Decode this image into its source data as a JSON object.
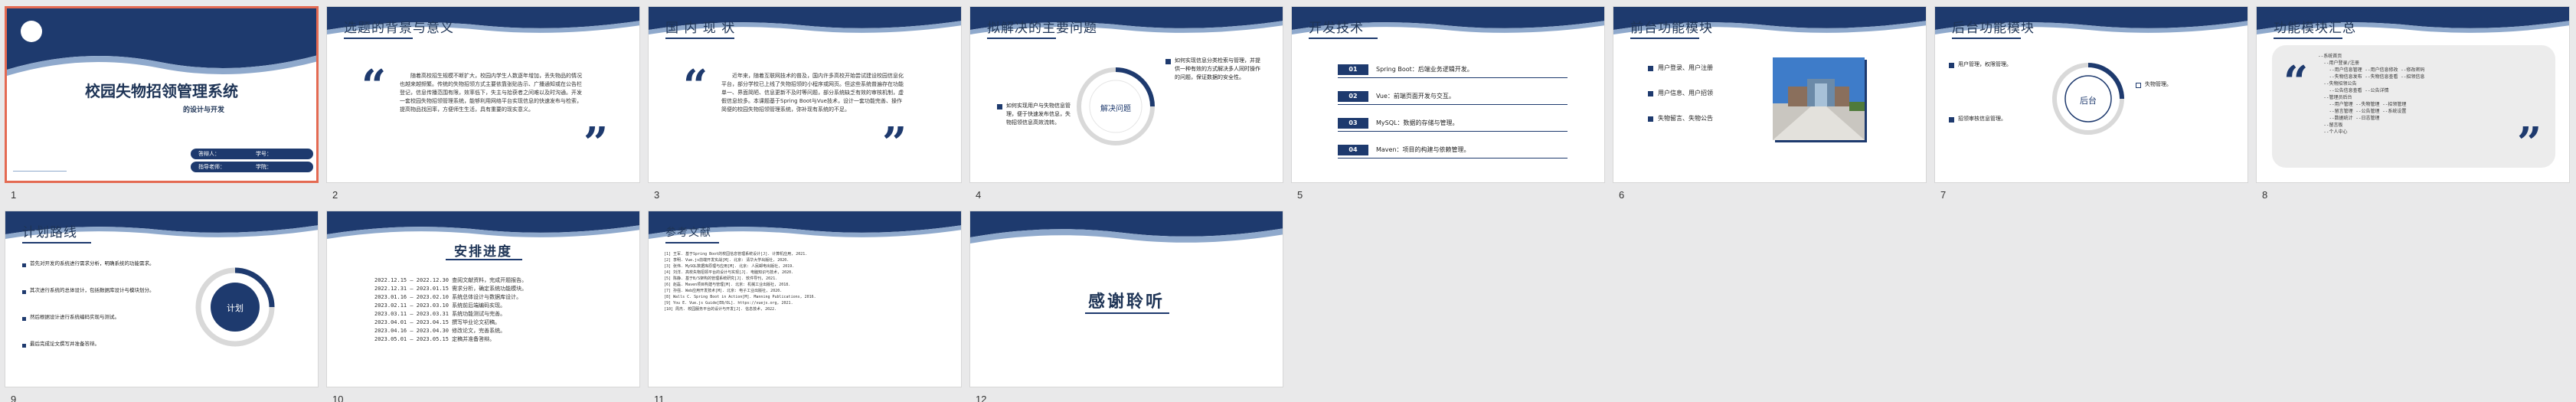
{
  "slides": [
    {
      "num": "1",
      "title": "校园失物招领管理系统",
      "subtitle": "的设计与开发",
      "info1_a": "答辩人：",
      "info1_b": "学号：",
      "info2_a": "指导老师：",
      "info2_b": "学院："
    },
    {
      "num": "2",
      "title": "选题的背景与意义",
      "para": "随着高校招生规模不断扩大，校园内学生人数逐年增加，丢失物品的情况也越来越频繁。传统的失物招领方式主要依靠张贴告示、广播通知或在公告栏登记，信息传播范围有限，效率低下，失主与拾获者之间难以及时沟通。开发一套校园失物招领管理系统，能够利用网络平台实现信息的快速发布与检索，提高物品找回率，方便师生生活，具有重要的现实意义。"
    },
    {
      "num": "3",
      "title": "国 内 现 状",
      "para": "近年来，随着互联网技术的普及，国内许多高校开始尝试建设校园信息化平台，部分学校已上线了失物招领的小程序或网页。但这些系统普遍存在功能单一、界面简陋、信息更新不及时等问题，部分系统缺乏有效的审核机制，虚假信息较多。本课题基于Spring Boot与Vue技术，设计一套功能完善、操作简便的校园失物招领管理系统，弥补现有系统的不足。"
    },
    {
      "num": "4",
      "title": "拟解决的主要问题",
      "center": "解决问题",
      "left": "如何实现用户与失物信息管理，便于快速发布信息，失物招领信息高效流转。",
      "right": "如何实现信息分类检索与管理，并提供一种有效的方式解决多人同时操作的问题，保证数据的安全性。"
    },
    {
      "num": "5",
      "title": "开发技术",
      "items": [
        {
          "n": "01",
          "t": "Spring Boot：后端业务逻辑开发。"
        },
        {
          "n": "02",
          "t": "Vue：前端页面开发与交互。"
        },
        {
          "n": "03",
          "t": "MySQL：数据的存储与管理。"
        },
        {
          "n": "04",
          "t": "Maven：项目的构建与依赖管理。"
        }
      ]
    },
    {
      "num": "6",
      "title": "前台功能模块",
      "items": [
        "用户登录、用户注册",
        "用户信息、用户招领",
        "失物留言、失物公告"
      ]
    },
    {
      "num": "7",
      "title": "后台功能模块",
      "center": "后台",
      "tl": "用户管理，权限管理。",
      "tr": "失物管理。",
      "bl": "招领审核信息管理。"
    },
    {
      "num": "8",
      "title": "功能模块汇总",
      "code": "--系统首页\n  --用户登录/注册\n    --用户信息管理 --用户信息修改 --修改密码\n    --失物信息发布 --失物信息查看 --招领信息\n  --失物招领公告\n    --公告信息查看 --公告详情\n  --管理员后台\n    --用户管理 --失物管理 --招领管理\n    --留言管理 --公告管理 --系统设置\n    --数据统计 --日志管理\n  --留言板\n  --个人中心"
    },
    {
      "num": "9",
      "title": "计划路线",
      "center": "计划",
      "items": [
        "首先对开发的系统进行需求分析，明确系统的功能需求。",
        "其次进行系统的总体设计，包括数据库设计与模块划分。",
        "然后根据设计进行系统编码实现与测试。",
        "最后完成论文撰写并准备答辩。"
      ]
    },
    {
      "num": "10",
      "title": "安排进度",
      "sched": "2022.12.15 — 2022.12.30 查阅文献资料，完成开题报告。\n2022.12.31 — 2023.01.15 需求分析，确定系统功能模块。\n2023.01.16 — 2023.02.10 系统总体设计与数据库设计。\n2023.02.11 — 2023.03.10 系统前后端编码实现。\n2023.03.11 — 2023.03.31 系统功能测试与完善。\n2023.04.01 — 2023.04.15 撰写毕业论文初稿。\n2023.04.16 — 2023.04.30 修改论文，完善系统。\n2023.05.01 — 2023.05.15 定稿并准备答辩。"
    },
    {
      "num": "11",
      "title": "参考文献",
      "refs": "[1] 王军. 基于Spring Boot的校园信息管理系统设计[J]. 计算机应用, 2021.\n[2] 李明. Vue.js前端开发实战[M]. 北京: 清华大学出版社, 2020.\n[3] 张伟. MySQL数据库原理与应用[M]. 北京: 人民邮电出版社, 2019.\n[4] 刘洋. 高校失物招领平台的设计与实现[J]. 电脑知识与技术, 2020.\n[5] 陈静. 基于B/S架构的管理系统研究[J]. 软件导刊, 2021.\n[6] 赵磊. Maven项目构建与管理[M]. 北京: 机械工业出版社, 2018.\n[7] 孙强. Web应用开发技术[M]. 北京: 电子工业出版社, 2020.\n[8] Walls C. Spring Boot in Action[M]. Manning Publications, 2016.\n[9] You E. Vue.js Guide[EB/OL]. https://vuejs.org, 2021.\n[10] 周杰. 校园服务平台的设计与开发[J]. 信息技术, 2022."
    },
    {
      "num": "12",
      "title": "感谢聆听"
    }
  ],
  "colors": {
    "navy": "#1e3a6e",
    "light": "#8fa9cc",
    "accent": "#e46a52"
  }
}
